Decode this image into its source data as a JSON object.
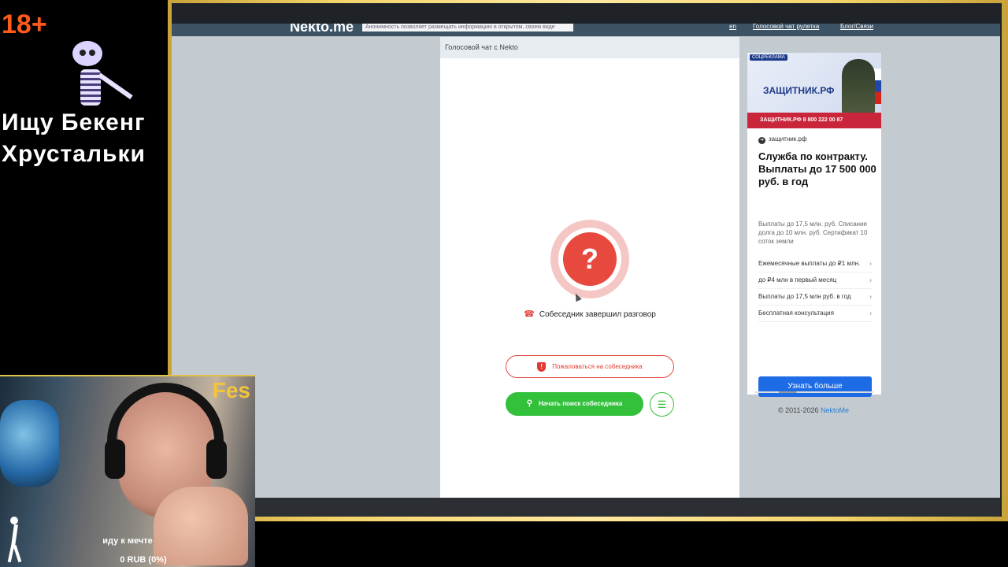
{
  "overlay": {
    "age_label": "18+",
    "line1": "Ищу Бекенг",
    "line2": "Хрустальки"
  },
  "navbar": {
    "logo": "Nekto.me",
    "notice": "Анонимность позволяет размещать информацию в открытом, своем виде",
    "link1": "en",
    "link2": "Голосовой чат рулетка",
    "link3": "Блог/Связи"
  },
  "chat": {
    "header": "Голосовой чат с Nekto",
    "question_mark": "?",
    "ended_text": "Собеседник завершил разговор",
    "report_button": "Пожаловаться на собеседника",
    "search_button": "Начать поиск собеседника"
  },
  "ad": {
    "tag": "СОЦРЕКЛАМА",
    "banner_site": "ЗАЩИТНИК.РФ",
    "banner_bar": "ЗАЩИТНИК.РФ  8 800 222 00 87",
    "source": "защитник.рф",
    "headline": "Служба по контракту. Выплаты до 17 500 000 руб. в год",
    "description": "Выплаты до 17,5 млн. руб. Списание долга до 10 млн. руб. Сертификат 10 соток земли",
    "items": [
      "Ежемесячные выплаты до ₽1 млн.",
      "до ₽4 млн в первый месяц",
      "Выплаты до 17,5 млн руб. в год",
      "Бесплатная консультация"
    ],
    "cta": "Узнать больше"
  },
  "footer": {
    "copyright": "© 2011-2026",
    "link": "NektoMe"
  },
  "webcam": {
    "brand": "Fes",
    "goal": "иду к мечте",
    "sum": "0 RUB (0%)"
  },
  "colors": {
    "accent_red": "#e8493f",
    "accent_green": "#33c13c",
    "cta_blue": "#1e6be6",
    "frame_gold": "#f3d36a"
  }
}
